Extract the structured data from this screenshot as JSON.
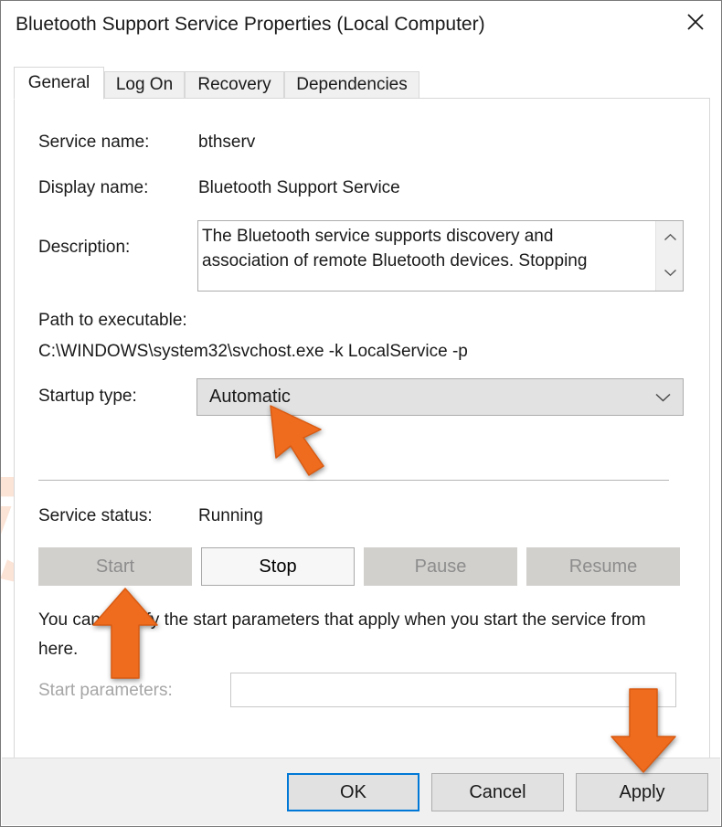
{
  "window": {
    "title": "Bluetooth Support Service Properties (Local Computer)",
    "close_label": "✕",
    "close_icon": "close-icon"
  },
  "tabs": [
    {
      "label": "General",
      "active": true
    },
    {
      "label": "Log On",
      "active": false
    },
    {
      "label": "Recovery",
      "active": false
    },
    {
      "label": "Dependencies",
      "active": false
    }
  ],
  "general": {
    "service_name_label": "Service name:",
    "service_name_value": "bthserv",
    "display_name_label": "Display name:",
    "display_name_value": "Bluetooth Support Service",
    "description_label": "Description:",
    "description_value": "The Bluetooth service supports discovery and association of remote Bluetooth devices.  Stopping",
    "scroll_up_icon": "chevron-up-icon",
    "scroll_down_icon": "chevron-down-icon",
    "path_label": "Path to executable:",
    "path_value": "C:\\WINDOWS\\system32\\svchost.exe -k LocalService -p",
    "startup_type_label": "Startup type:",
    "startup_type_value": "Automatic",
    "startup_type_chevron": "chevron-down-icon",
    "service_status_label": "Service status:",
    "service_status_value": "Running",
    "buttons": [
      {
        "label": "Start",
        "enabled": false
      },
      {
        "label": "Stop",
        "enabled": true
      },
      {
        "label": "Pause",
        "enabled": false
      },
      {
        "label": "Resume",
        "enabled": false
      }
    ],
    "hint_text": "You can specify the start parameters that apply when you start the service from here.",
    "start_parameters_label": "Start parameters:",
    "start_parameters_value": "",
    "start_parameters_enabled": false
  },
  "footer": {
    "ok_label": "OK",
    "cancel_label": "Cancel",
    "apply_label": "Apply"
  },
  "annotations": {
    "color": "#ef6c1f",
    "arrow_startup_type": "cursor-arrow-pointing-startup-type",
    "arrow_start_button": "up-arrow-pointing-start-button",
    "arrow_apply_button": "down-arrow-pointing-apply-button"
  }
}
